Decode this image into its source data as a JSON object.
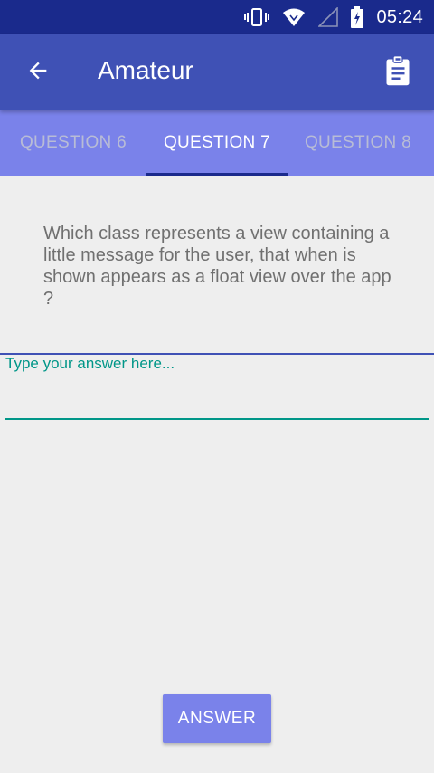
{
  "status_bar": {
    "time": "05:24",
    "icons": [
      "vibrate-icon",
      "wifi-icon",
      "signal-icon",
      "battery-icon"
    ]
  },
  "app_bar": {
    "title": "Amateur",
    "back_icon": "arrow-back-icon",
    "action_icon": "clipboard-icon"
  },
  "tabs": [
    {
      "label": "QUESTION 6",
      "active": false
    },
    {
      "label": "QUESTION 7",
      "active": true
    },
    {
      "label": "QUESTION 8",
      "active": false
    }
  ],
  "question": {
    "text": "Which class represents a view containing a little message for the user, that when is shown appears as a float view over the app ?"
  },
  "answer": {
    "hint": "Type your answer here...",
    "value": ""
  },
  "submit_button": {
    "label": "ANSWER"
  },
  "colors": {
    "status_bar": "#1a2a8c",
    "app_bar": "#3f51b5",
    "tabs": "#7a82ea",
    "accent": "#009688"
  }
}
